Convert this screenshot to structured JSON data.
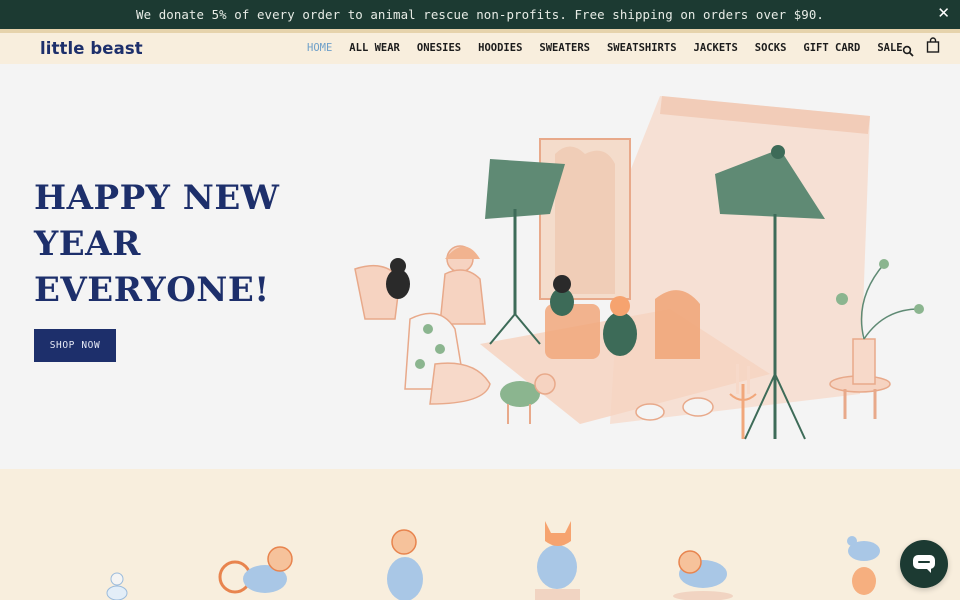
{
  "announcement": {
    "text": "We donate 5% of every order to animal rescue non-profits. Free shipping on orders over $90.",
    "close_icon": "close-icon",
    "close_glyph": "✕"
  },
  "header": {
    "logo": "little beast",
    "nav": [
      {
        "label": "HOME",
        "active": true
      },
      {
        "label": "ALL WEAR",
        "active": false
      },
      {
        "label": "ONESIES",
        "active": false
      },
      {
        "label": "HOODIES",
        "active": false
      },
      {
        "label": "SWEATERS",
        "active": false
      },
      {
        "label": "SWEATSHIRTS",
        "active": false
      },
      {
        "label": "JACKETS",
        "active": false
      },
      {
        "label": "SOCKS",
        "active": false
      },
      {
        "label": "GIFT CARD",
        "active": false
      },
      {
        "label": "SALE",
        "active": false
      }
    ],
    "icons": [
      "search-icon",
      "cart-icon"
    ]
  },
  "hero": {
    "title": "HAPPY NEW YEAR EVERYONE!",
    "button": "SHOP NOW"
  },
  "colors": {
    "announcement_bg": "#1c3a32",
    "header_bg": "#f8eedd",
    "brand_navy": "#1d2f6b",
    "nav_active": "#6fa0c9",
    "hero_bg": "#f4f4f4",
    "chat_bg": "#1c3a32"
  },
  "chat": {
    "icon": "chat-icon"
  }
}
